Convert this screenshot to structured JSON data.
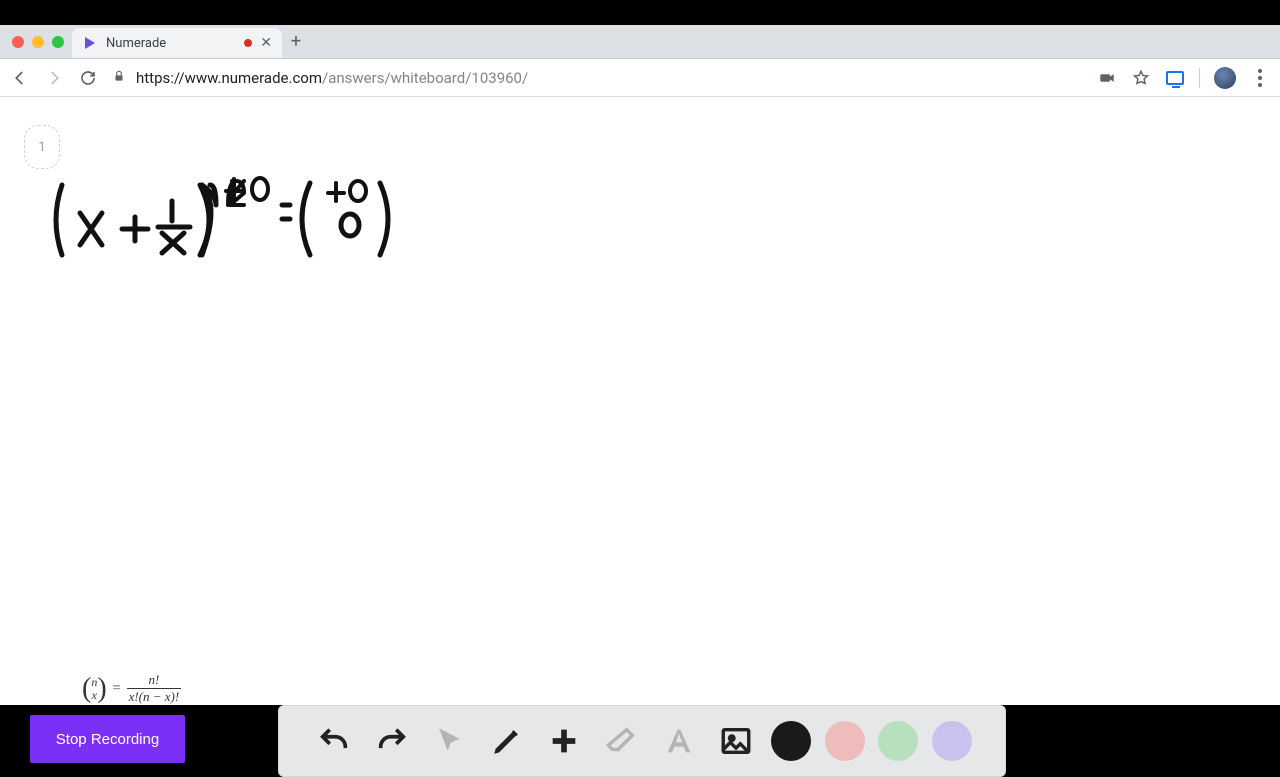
{
  "browser": {
    "tab_title": "Numerade",
    "url_host": "https://www.numerade.com",
    "url_path": "/answers/whiteboard/103960/"
  },
  "page": {
    "slot_number": "1"
  },
  "equation": {
    "expression": "(x + 1/x)^40 = (40 choose 0)"
  },
  "formula": {
    "binom_top": "n",
    "binom_bottom": "x",
    "eq": "=",
    "frac_num": "n!",
    "frac_den": "x!(n − x)!"
  },
  "controls": {
    "stop_label": "Stop Recording"
  },
  "toolbar": {
    "undo": "undo",
    "redo": "redo",
    "cursor": "cursor",
    "pen": "pen",
    "plus": "plus",
    "eraser": "eraser",
    "text": "text",
    "image": "image"
  },
  "colors": {
    "black": "#1a1a1a",
    "red": "#eebdbb",
    "green": "#b8e0bf",
    "purple": "#c7c3ee"
  }
}
